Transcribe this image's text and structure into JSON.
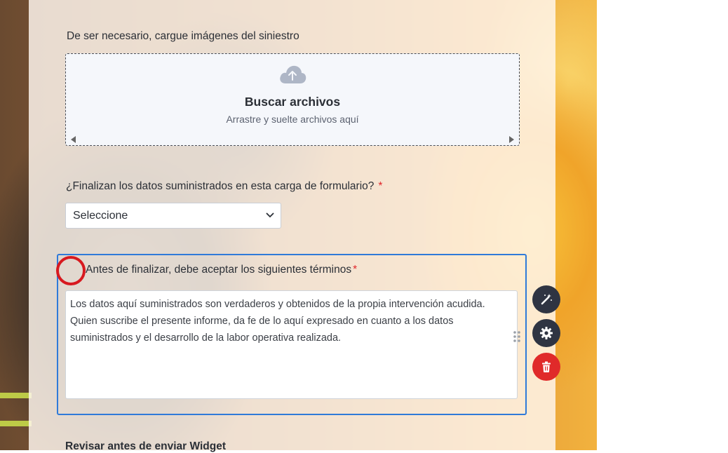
{
  "upload": {
    "label": "De ser necesario, cargue imágenes del siniestro",
    "title": "Buscar archivos",
    "subtitle": "Arrastre y suelte archivos aquí",
    "icon": "cloud-upload-icon"
  },
  "question": {
    "label": "¿Finalizan los datos suministrados en esta carga de formulario?",
    "required_mark": "*",
    "select_value": "Seleccione"
  },
  "terms": {
    "label": "Antes de finalizar, debe aceptar los siguientes términos",
    "required_mark": "*",
    "text": "Los datos aquí suministrados son verdaderos y obtenidos de la propia intervención acudida. Quien suscribe el presente informe, da fe de lo aquí expresado en cuanto a los datos suministrados y el desarrollo de la labor operativa realizada."
  },
  "actions": {
    "wand_icon": "magic-wand-icon",
    "gear_icon": "gear-icon",
    "trash_icon": "trash-icon"
  },
  "next_section": {
    "label": "Revisar antes de enviar Widget"
  },
  "colors": {
    "accent": "#2f7ad9",
    "required": "#e0262a",
    "delete": "#e02a2a",
    "dark_button": "#2f3442"
  }
}
